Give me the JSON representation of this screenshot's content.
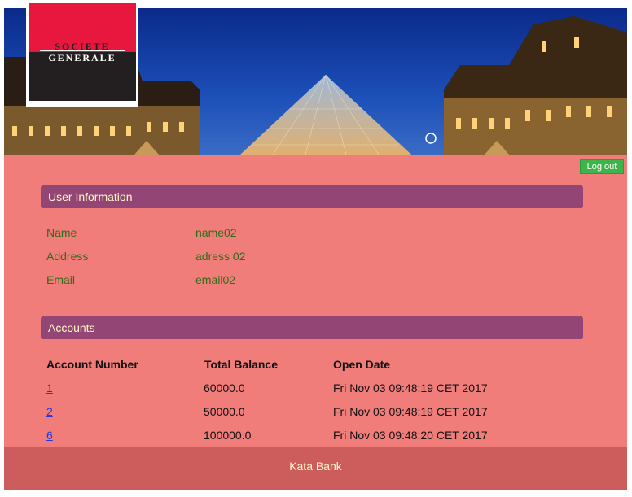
{
  "banner": {
    "logo_top": "SOCIETE",
    "logo_bottom": "GENERALE"
  },
  "header": {
    "logout_label": "Log out"
  },
  "user_info": {
    "title": "User Information",
    "rows": [
      {
        "label": "Name",
        "value": "name02"
      },
      {
        "label": "Address",
        "value": "adress 02"
      },
      {
        "label": "Email",
        "value": "email02"
      }
    ]
  },
  "accounts": {
    "title": "Accounts",
    "columns": [
      "Account Number",
      "Total Balance",
      "Open Date"
    ],
    "rows": [
      {
        "number": "1",
        "balance": "60000.0",
        "date": "Fri Nov 03 09:48:19 CET 2017"
      },
      {
        "number": "2",
        "balance": "50000.0",
        "date": "Fri Nov 03 09:48:19 CET 2017"
      },
      {
        "number": "6",
        "balance": "100000.0",
        "date": "Fri Nov 03 09:48:20 CET 2017"
      }
    ]
  },
  "footer": {
    "text": "Kata Bank"
  },
  "colors": {
    "main_bg": "#f07d7a",
    "panel_header": "#934575",
    "panel_header_text": "#fff8c4",
    "info_text": "#2f6b16",
    "logout_green": "#3eb54a",
    "footer_bg": "#cd5c5c",
    "link": "#2a3ad8"
  }
}
